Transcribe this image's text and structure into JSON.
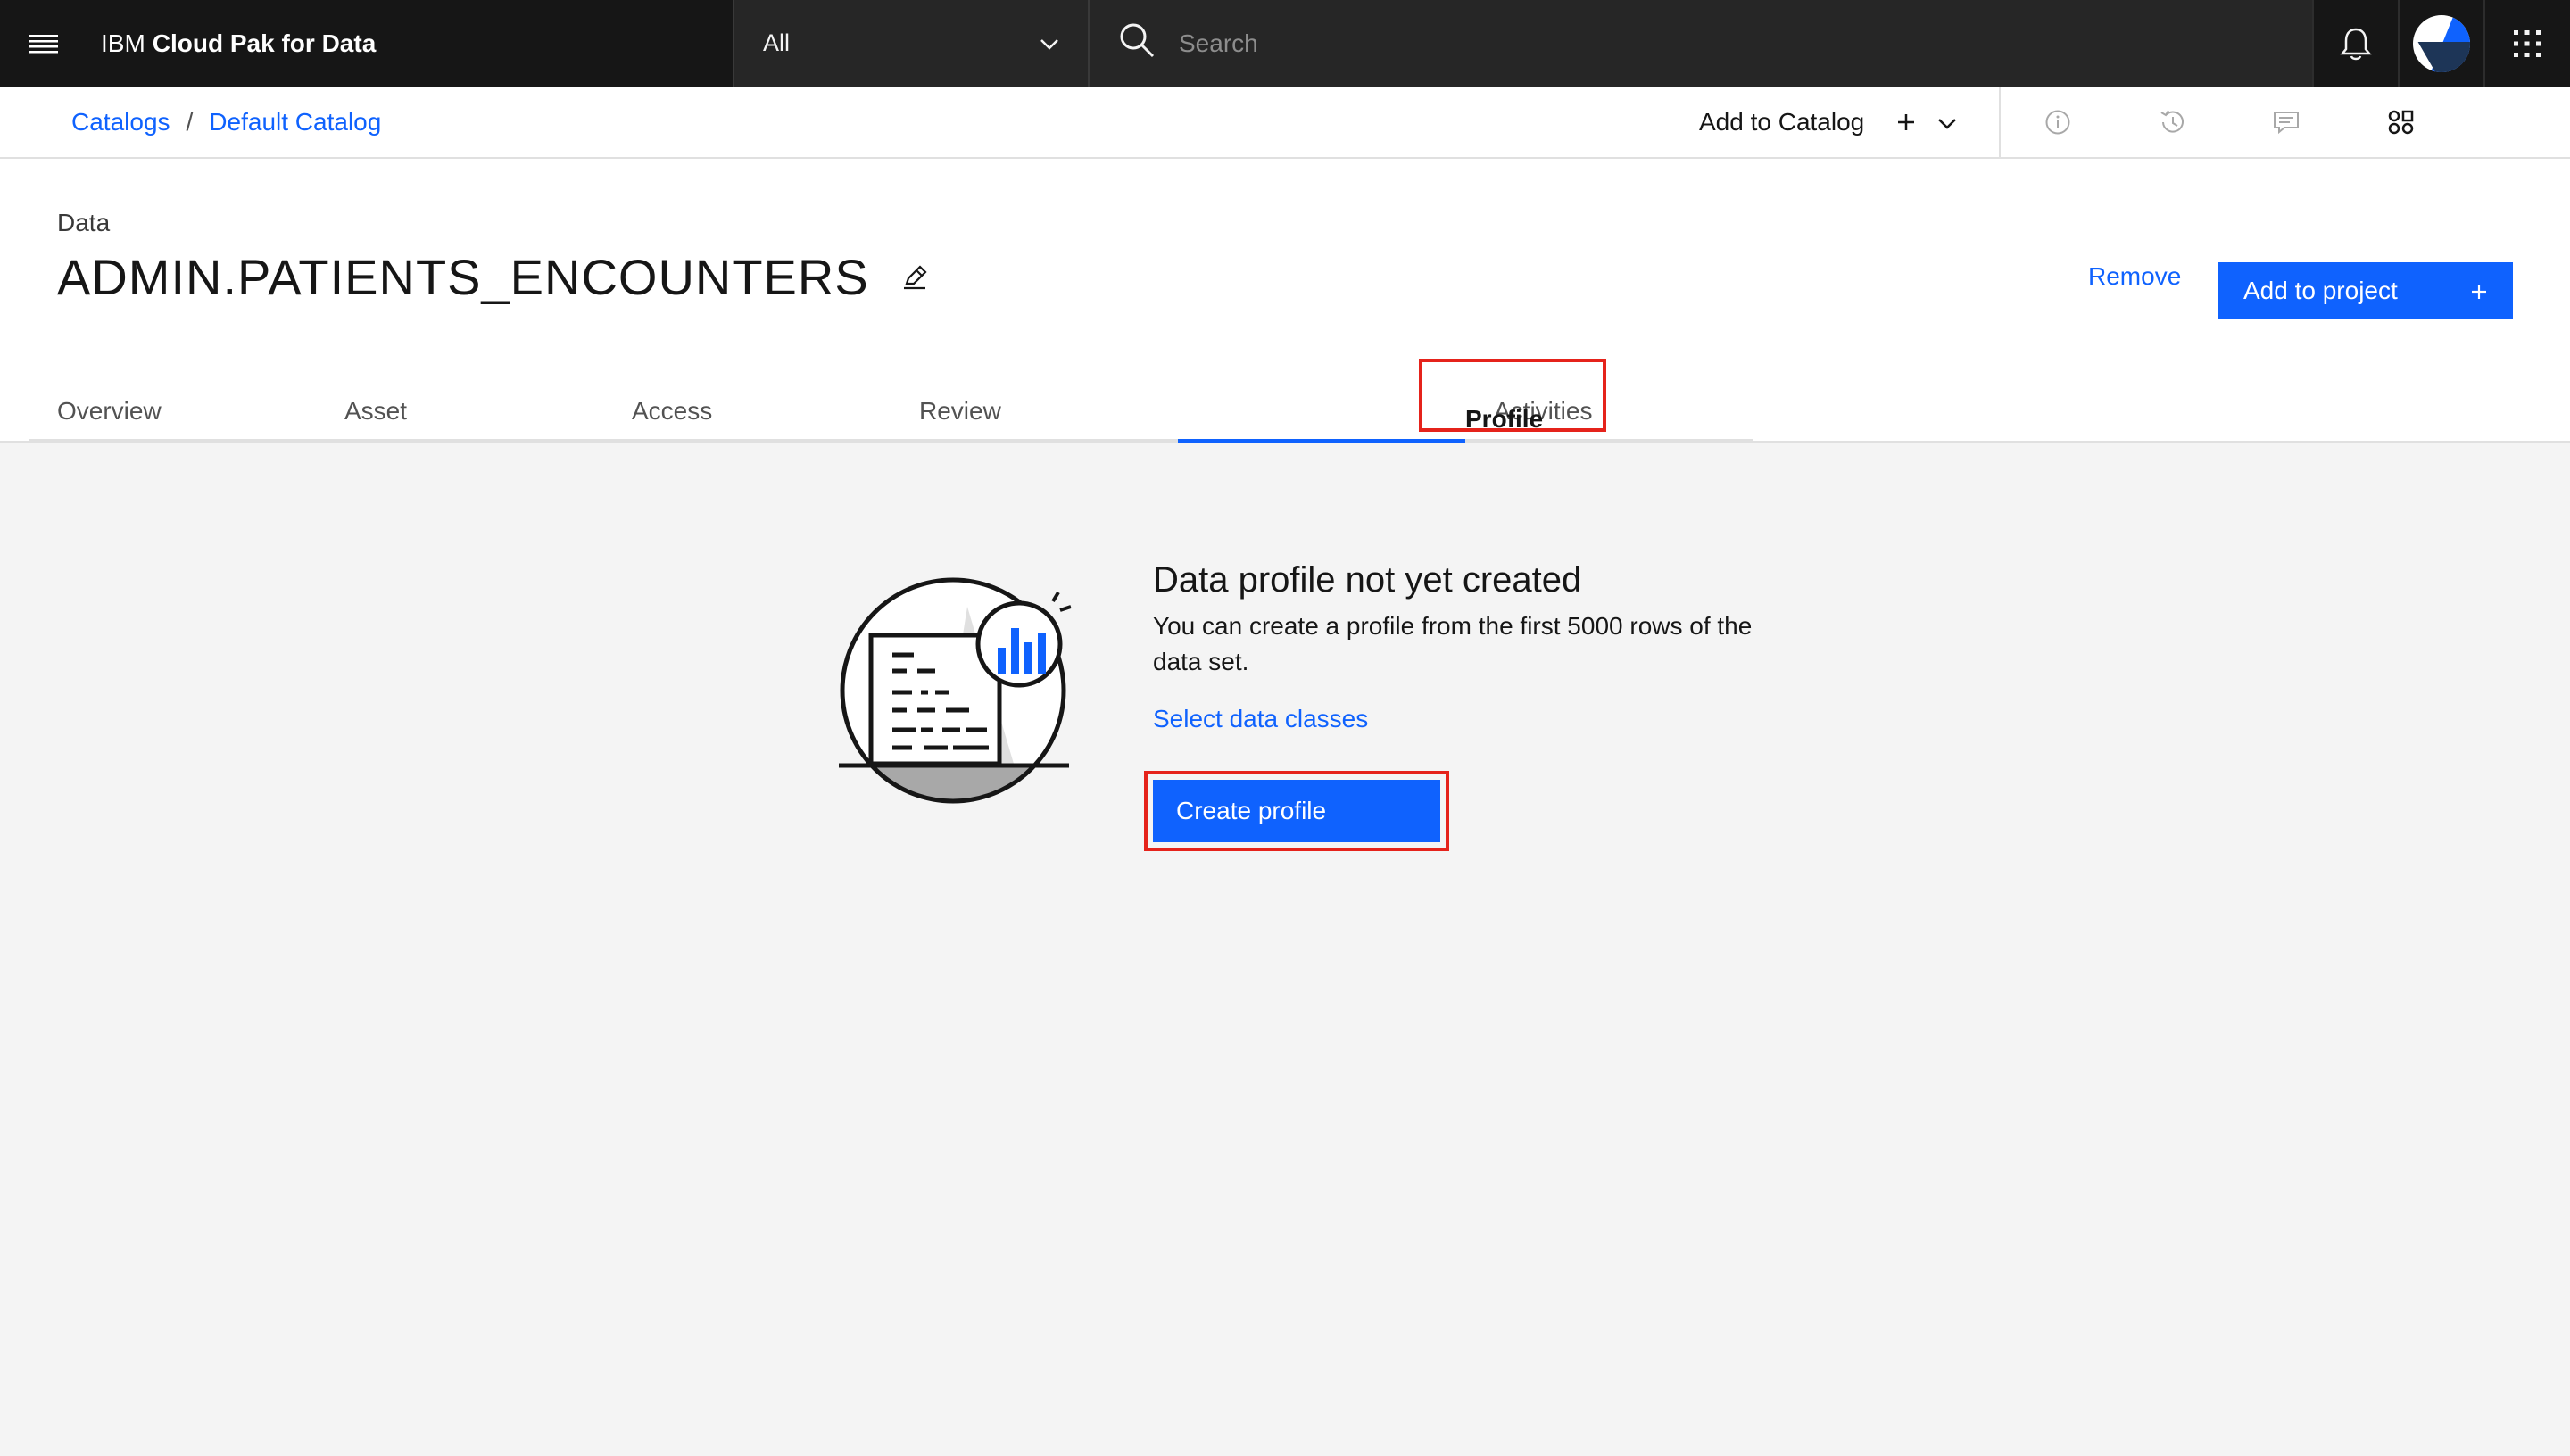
{
  "header": {
    "brand_prefix": "IBM",
    "brand_name": "Cloud Pak for Data",
    "scope_value": "All",
    "search_placeholder": "Search"
  },
  "subheader": {
    "breadcrumb": [
      "Catalogs",
      "Default Catalog"
    ],
    "breadcrumb_separator": "/",
    "add_to_catalog_label": "Add to Catalog"
  },
  "asset": {
    "type": "Data",
    "title": "ADMIN.PATIENTS_ENCOUNTERS",
    "remove_label": "Remove",
    "add_to_project_label": "Add to project"
  },
  "tabs": [
    {
      "label": "Overview",
      "active": false
    },
    {
      "label": "Asset",
      "active": false
    },
    {
      "label": "Access",
      "active": false
    },
    {
      "label": "Review",
      "active": false
    },
    {
      "label": "Profile",
      "active": true
    },
    {
      "label": "Activities",
      "active": false
    }
  ],
  "empty_state": {
    "title": "Data profile not yet created",
    "description": "You can create a profile from the first 5000 rows of the data set.",
    "link_label": "Select data classes",
    "button_label": "Create profile"
  },
  "colors": {
    "accent": "#0f62fe",
    "highlight": "#e5231b",
    "header_bg": "#161616"
  },
  "icons": [
    "menu-icon",
    "chevron-down-icon",
    "search-icon",
    "notification-icon",
    "avatar",
    "app-switcher-icon",
    "information-icon",
    "history-icon",
    "comment-icon",
    "manage-icon",
    "edit-icon",
    "empty-profile-illustration"
  ]
}
